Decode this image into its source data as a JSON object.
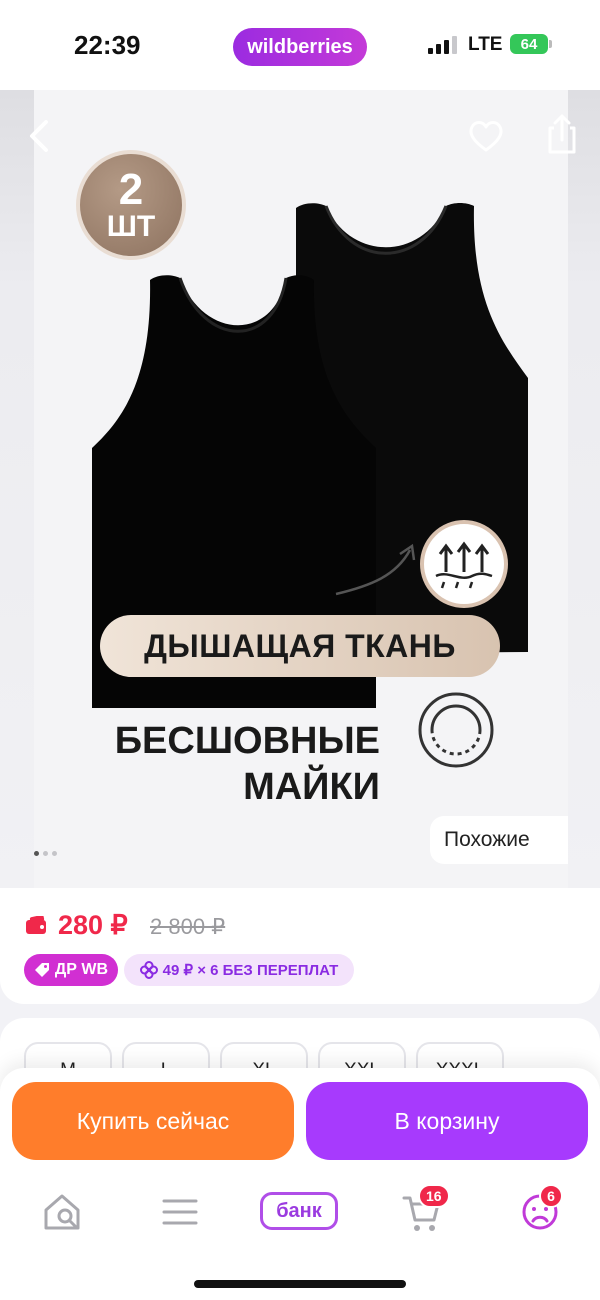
{
  "status_bar": {
    "time": "22:39",
    "app_pill": "wildberries",
    "network": "LTE",
    "battery": "64"
  },
  "product_image": {
    "badge_count": "2",
    "badge_unit": "ШТ",
    "banner_text": "ДЫШАЩАЯ ТКАНЬ",
    "caption_line1": "БЕСШОВНЫЕ",
    "caption_line2": "МАЙКИ",
    "similar_label": "Похожие",
    "slide_count": 3,
    "active_slide": 1
  },
  "price": {
    "current": "280 ₽",
    "old": "2 800 ₽",
    "tag_dr": "ДР WB",
    "tag_split": "49 ₽ × 6 БЕЗ ПЕРЕПЛАТ"
  },
  "sizes": [
    "M",
    "L",
    "XL",
    "XXL",
    "XXXL"
  ],
  "actions": {
    "buy_now": "Купить сейчас",
    "to_cart": "В корзину"
  },
  "tabbar": {
    "bank_label": "банк",
    "cart_count": "16",
    "profile_count": "6"
  },
  "colors": {
    "accent_purple": "#a73afd",
    "accent_orange": "#ff7d2b",
    "price_red": "#f0284a"
  }
}
